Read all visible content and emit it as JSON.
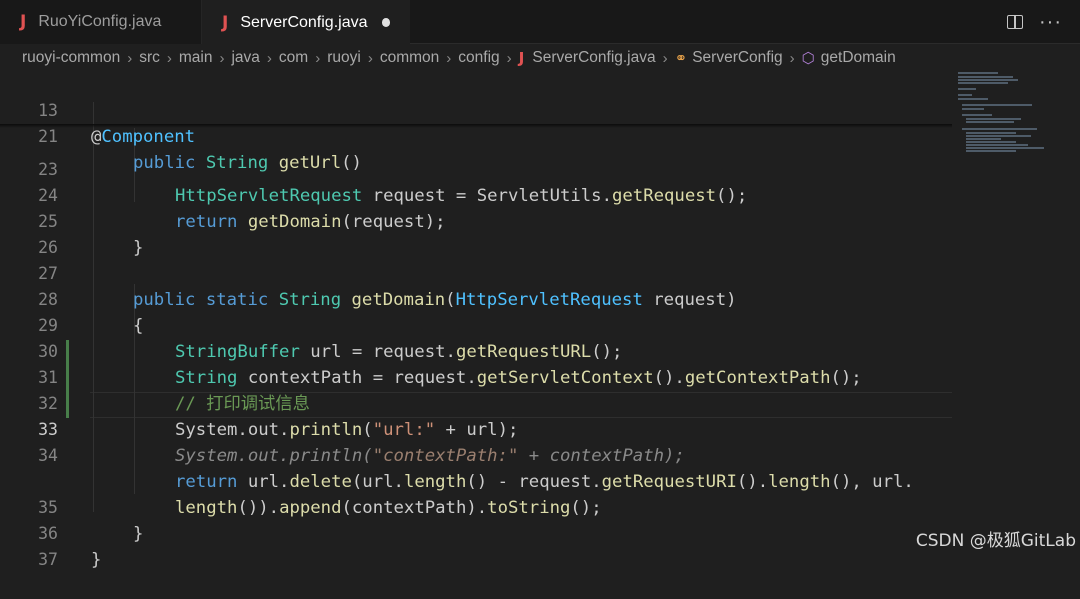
{
  "tabs": [
    {
      "icon": "J",
      "label": "RuoYiConfig.java"
    },
    {
      "icon": "J",
      "label": "ServerConfig.java"
    }
  ],
  "breadcrumb": [
    "ruoyi-common",
    "src",
    "main",
    "java",
    "com",
    "ruoyi",
    "common",
    "config"
  ],
  "breadcrumb_file": {
    "icon": "J",
    "label": "ServerConfig.java"
  },
  "breadcrumb_class": "ServerConfig",
  "breadcrumb_method": "getDomain",
  "line_numbers": [
    "13",
    "21",
    "23",
    "24",
    "25",
    "26",
    "27",
    "28",
    "29",
    "30",
    "31",
    "32",
    "33",
    "34",
    "",
    "35",
    "36",
    "37"
  ],
  "code": {
    "l13": {
      "at": "@",
      "ann": "Component"
    },
    "l21": {
      "kw": "public",
      "ty": "String",
      "fn": "getUrl",
      "rest": "()"
    },
    "l23": {
      "ty": "HttpServletRequest",
      "rest1": " request = ",
      "cls": "ServletUtils",
      "dot": ".",
      "fn": "getRequest",
      "rest2": "();"
    },
    "l24": {
      "kw": "return",
      "fn": "getDomain",
      "rest": "(request);"
    },
    "l25": {
      "text": "}"
    },
    "l27": {
      "kw1": "public",
      "kw2": "static",
      "ty": "String",
      "fn": "getDomain",
      "p1": "(",
      "pty": "HttpServletRequest",
      "p2": " request)"
    },
    "l28": {
      "text": "{"
    },
    "l29": {
      "ty": "StringBuffer",
      "a": " url = request.",
      "fn": "getRequestURL",
      "b": "();"
    },
    "l30": {
      "ty": "String",
      "a": " contextPath = request.",
      "fn1": "getServletContext",
      "b": "().",
      "fn2": "getContextPath",
      "c": "();"
    },
    "l31": {
      "comment": "// 打印调试信息"
    },
    "l32": {
      "a": "System.out.",
      "fn": "println",
      "b": "(",
      "str": "\"url:\"",
      "c": " + url);"
    },
    "l33": {
      "a": "System.out.println(",
      "str": "\"contextPath:\"",
      "b": " + contextPath);"
    },
    "l34": {
      "kw": "return",
      "a": " url.",
      "fn1": "delete",
      "b": "(url.",
      "fn2": "length",
      "c": "() - request.",
      "fn3": "getRequestURI",
      "d": "().",
      "fn4": "length",
      "e": "(), url."
    },
    "l34b": {
      "fn1": "length",
      "a": "()).",
      "fn2": "append",
      "b": "(contextPath).",
      "fn3": "toString",
      "c": "();"
    },
    "l35": {
      "text": "}"
    },
    "l36": {
      "text": "}"
    }
  },
  "watermark": "CSDN @极狐GitLab",
  "colors": {
    "background": "#1f1f1f",
    "keyword": "#569cd6",
    "type": "#4ec9b0",
    "function": "#dcdcaa",
    "comment": "#6a9955",
    "string": "#ce9178"
  }
}
